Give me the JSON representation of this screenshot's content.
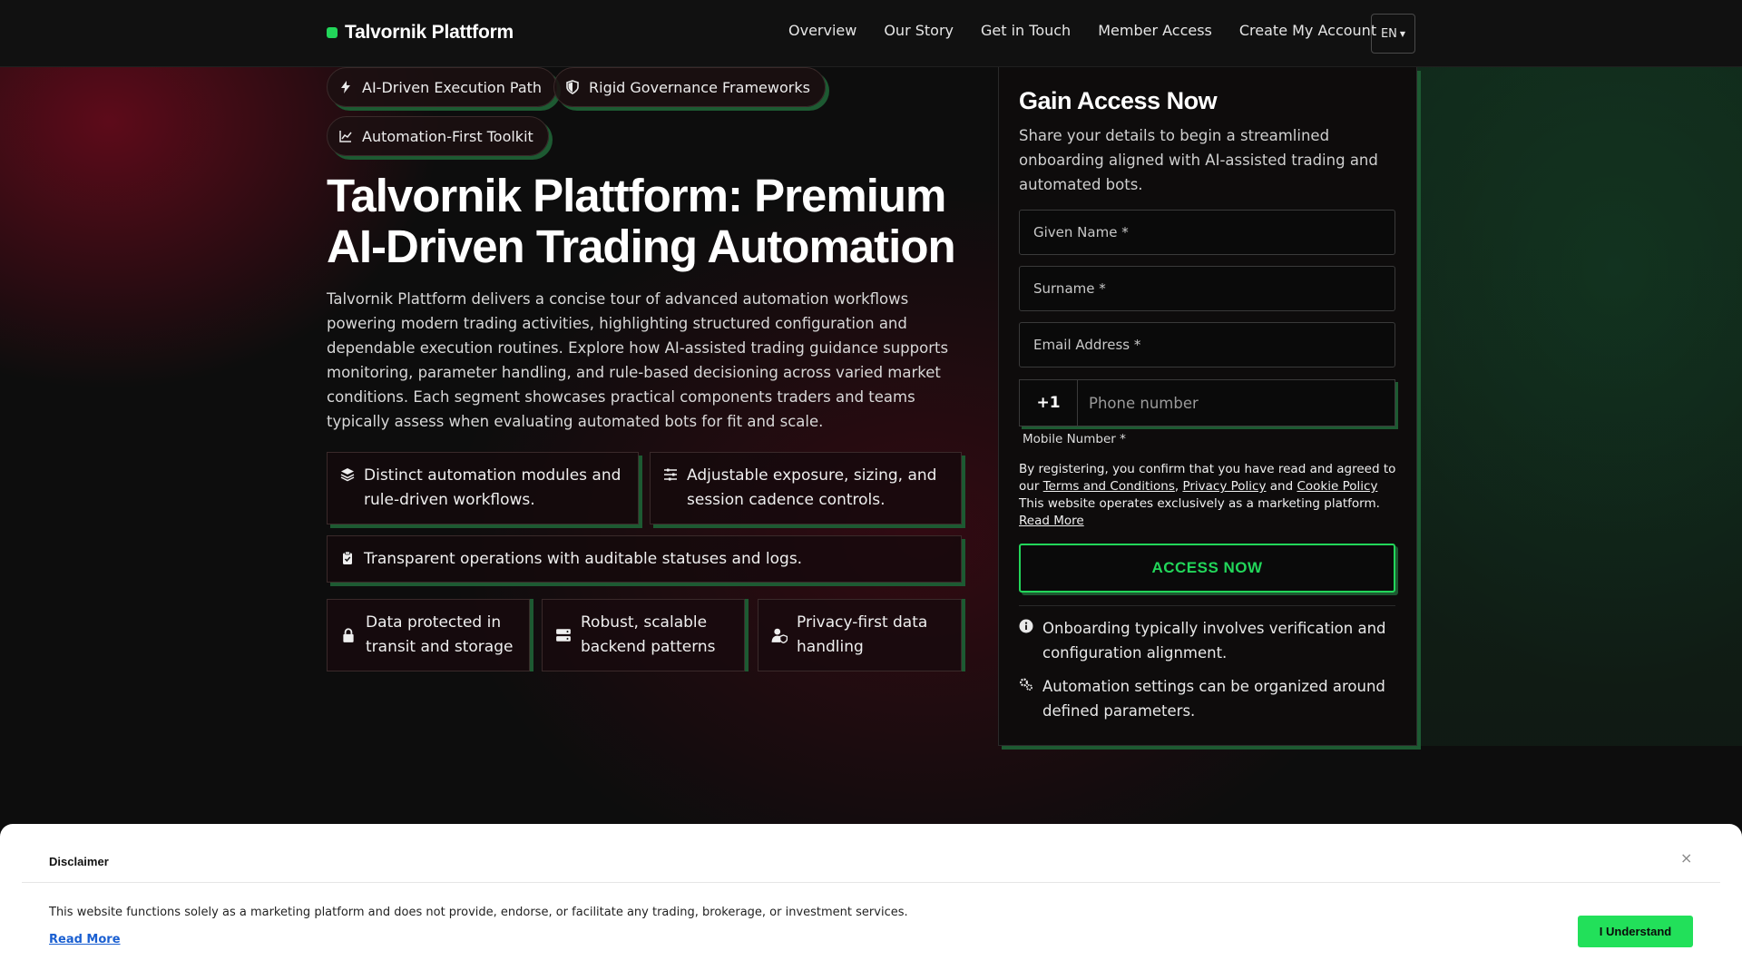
{
  "header": {
    "brand": "Talvornik Plattform",
    "nav": [
      "Overview",
      "Our Story",
      "Get in Touch",
      "Member Access",
      "Create My Account"
    ],
    "lang": "EN"
  },
  "badges": [
    "AI-Driven Execution Path",
    "Rigid Governance Frameworks",
    "Automation-First Toolkit"
  ],
  "hero": {
    "title": "Talvornik Plattform: Premium AI-Driven Trading Automation",
    "description": "Talvornik Plattform delivers a concise tour of advanced automation workflows powering modern trading activities, highlighting structured configuration and dependable execution routines. Explore how AI-assisted trading guidance supports monitoring, parameter handling, and rule-based decisioning across varied market conditions. Each segment showcases practical components traders and teams typically assess when evaluating automated bots for fit and scale."
  },
  "features": [
    "Distinct automation modules and rule-driven workflows.",
    "Adjustable exposure, sizing, and session cadence controls.",
    "Transparent operations with auditable statuses and logs."
  ],
  "mini_features": [
    "Data protected in transit and storage",
    "Robust, scalable backend patterns",
    "Privacy-first data handling"
  ],
  "form": {
    "title": "Gain Access Now",
    "subtitle": "Share your details to begin a streamlined onboarding aligned with AI-assisted trading and automated bots.",
    "given_name": "Given Name *",
    "surname": "Surname *",
    "email": "Email Address *",
    "phone_code": "+1",
    "phone_placeholder": "Phone number",
    "phone_label": "Mobile Number *",
    "legal_prefix": "By registering, you confirm that you have read and agreed to our",
    "terms": "Terms and Conditions",
    "privacy": "Privacy Policy",
    "and": "and",
    "cookie": "Cookie Policy",
    "legal_suffix": "This website operates exclusively as a marketing platform.",
    "read_more": "Read More",
    "submit": "ACCESS NOW",
    "notes": [
      "Onboarding typically involves verification and configuration alignment.",
      "Automation settings can be organized around defined parameters."
    ]
  },
  "disclaimer": {
    "title": "Disclaimer",
    "close": "×",
    "text": "This website functions solely as a marketing platform and does not provide, endorse, or facilitate any trading, brokerage, or investment services.",
    "read_more": "Read More",
    "button": "I Understand"
  },
  "colors": {
    "accent": "#22d65a",
    "shadow_green": "#1d5a32",
    "bg": "#0c0c0c"
  }
}
